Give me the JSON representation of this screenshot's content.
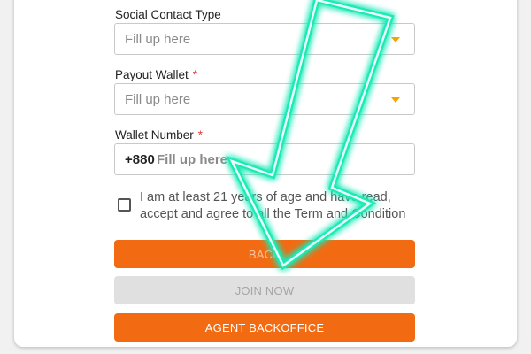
{
  "form": {
    "social_contact": {
      "label": "Social Contact Type",
      "placeholder": "Fill up here"
    },
    "payout_wallet": {
      "label": "Payout Wallet",
      "required_mark": "*",
      "placeholder": "Fill up here"
    },
    "wallet_number": {
      "label": "Wallet Number",
      "required_mark": "*",
      "prefix": "+880",
      "placeholder": "Fill up here"
    },
    "terms": {
      "text": "I am at least 21 years of age and have read, accept and agree to all the Term and Condition",
      "checked": false
    }
  },
  "buttons": {
    "back_label": "BACK",
    "join_label": "JOIN NOW",
    "agent_label": "AGENT BACKOFFICE"
  },
  "colors": {
    "accent": "#f26b12",
    "dropdown_caret": "#f5a300",
    "arrow_glow": "#1de9b6"
  },
  "overlay": {
    "icon": "down-arrow-icon"
  }
}
